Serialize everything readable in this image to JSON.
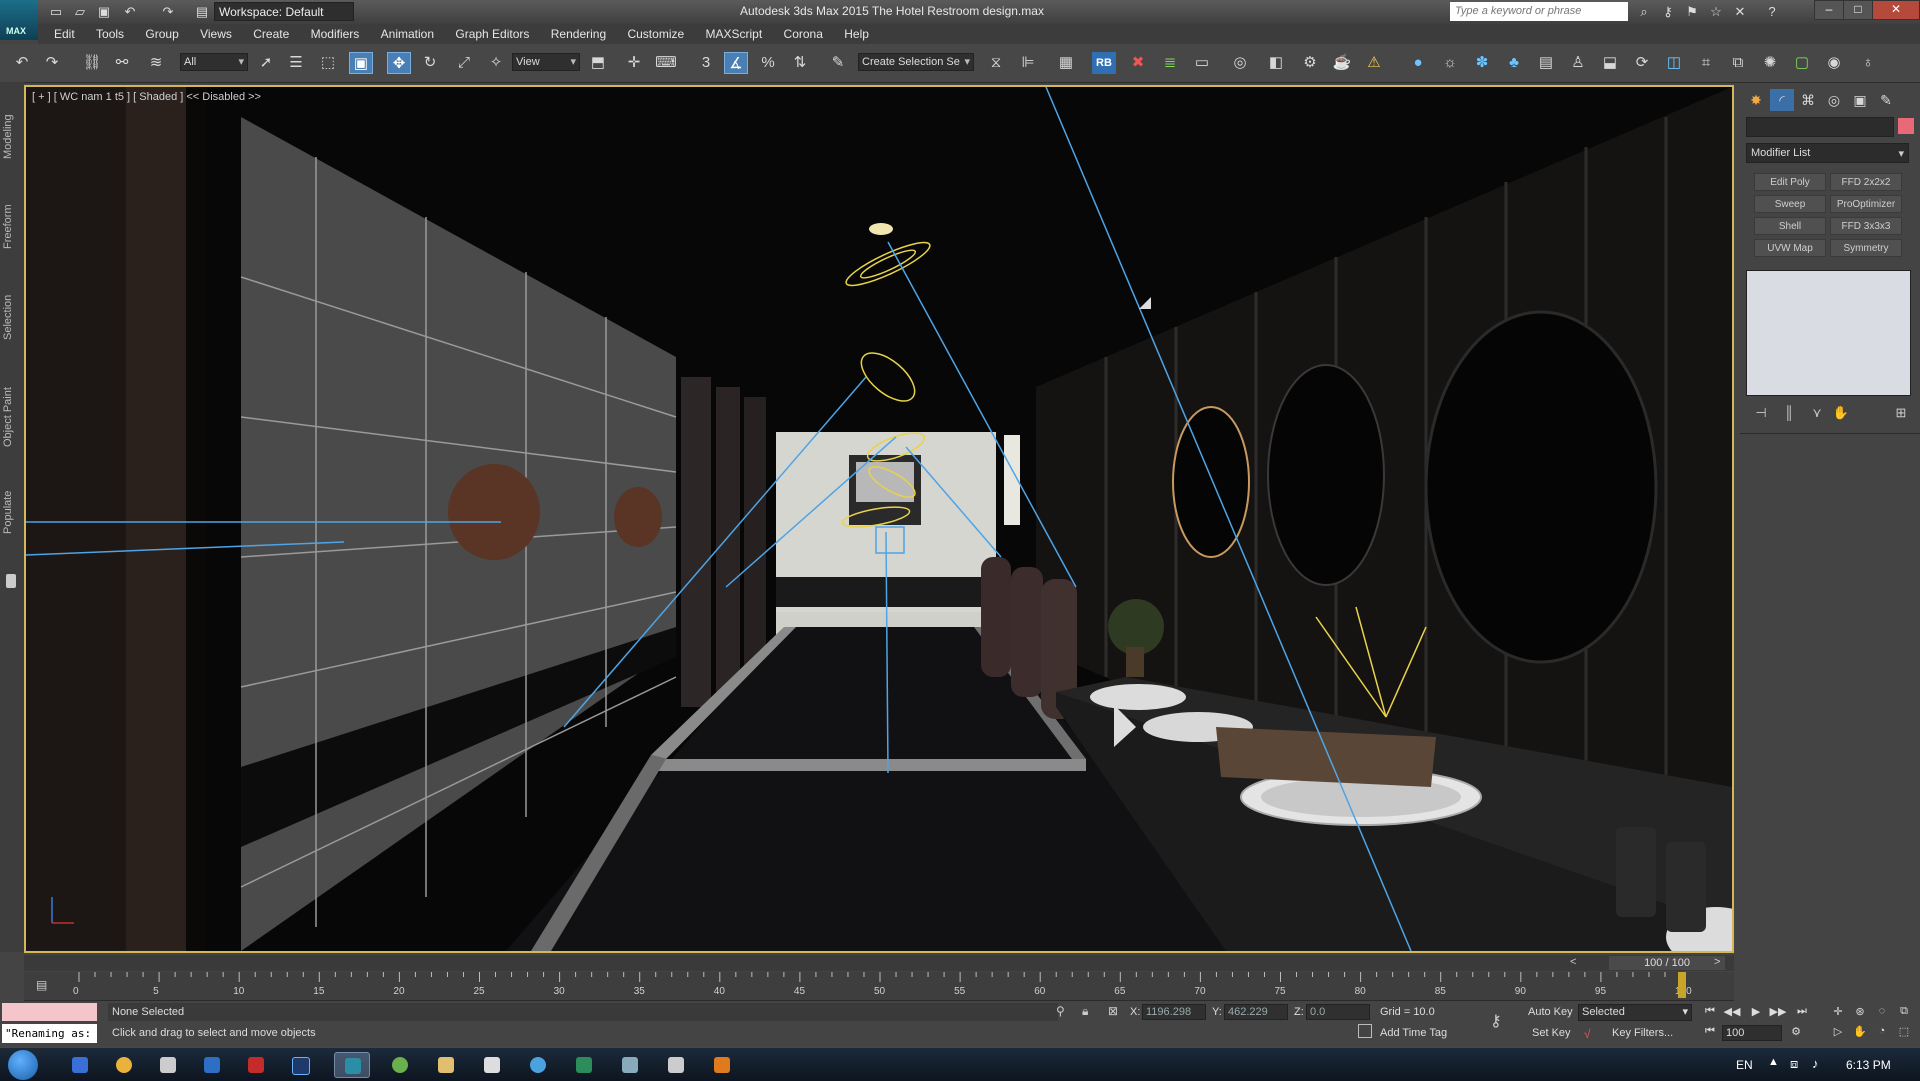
{
  "titlebar": {
    "app_label": "MAX",
    "workspace": "Workspace: Default",
    "title": "Autodesk 3ds Max 2015     The Hotel Restroom design.max",
    "search_placeholder": "Type a keyword or phrase"
  },
  "menubar": {
    "items": [
      "Edit",
      "Tools",
      "Group",
      "Views",
      "Create",
      "Modifiers",
      "Animation",
      "Graph Editors",
      "Rendering",
      "Customize",
      "MAXScript",
      "Corona",
      "Help"
    ]
  },
  "toolbar": {
    "selection_filter": "All",
    "ref_coord": "View",
    "named_selection": "Create Selection Se",
    "snap_label": "3",
    "percent_snap": "%",
    "rb_label": "RB"
  },
  "lefttabs": [
    "Modeling",
    "Freeform",
    "Selection",
    "Object Paint",
    "Populate"
  ],
  "viewport": {
    "label": "[ + ] [ WC nam 1 t5 ] [ Shaded ]  << Disabled >>"
  },
  "cmdpanel": {
    "modifier_list": "Modifier List",
    "modifiers": [
      "Edit Poly",
      "FFD 2x2x2",
      "Sweep",
      "ProOptimizer",
      "Shell",
      "FFD 3x3x3",
      "UVW Map",
      "Symmetry"
    ],
    "object_color": "#e86a78"
  },
  "timeline": {
    "frame_indicator": "100 / 100",
    "ticks": [
      "0",
      "5",
      "10",
      "15",
      "20",
      "25",
      "30",
      "35",
      "40",
      "45",
      "50",
      "55",
      "60",
      "65",
      "70",
      "75",
      "80",
      "85",
      "90",
      "95",
      "100"
    ]
  },
  "status": {
    "maxscript_text": "\"Renaming as:",
    "selection": "None Selected",
    "prompt": "Click and drag to select and move objects",
    "x_label": "X:",
    "x_value": "1196.298",
    "y_label": "Y:",
    "y_value": "462.229",
    "z_label": "Z:",
    "z_value": "0.0",
    "grid": "Grid = 10.0",
    "add_time_tag": "Add Time Tag",
    "auto_key": "Auto Key",
    "set_key": "Set Key",
    "key_mode": "Selected",
    "key_filters": "Key Filters...",
    "current_frame": "100"
  },
  "taskbar": {
    "lang": "EN",
    "clock": "6:13 PM"
  }
}
